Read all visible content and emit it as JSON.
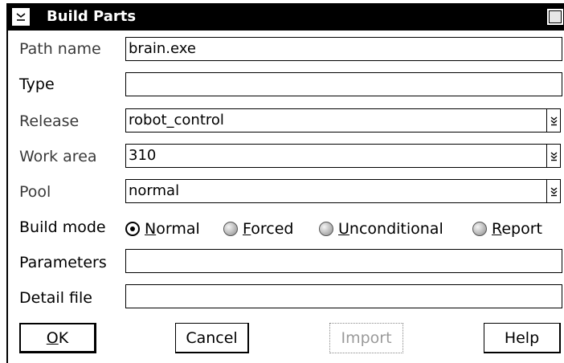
{
  "window": {
    "title": "Build Parts"
  },
  "labels": {
    "path_name": "Path name",
    "type": "Type",
    "release": "Release",
    "work_area": "Work area",
    "pool": "Pool",
    "build_mode": "Build mode",
    "parameters": "Parameters",
    "detail_file": "Detail file"
  },
  "fields": {
    "path_name": "brain.exe",
    "type": "",
    "release": "robot_control",
    "work_area": "310",
    "pool": "normal",
    "parameters": "",
    "detail_file": ""
  },
  "build_mode": {
    "selected": "Normal",
    "options": [
      {
        "mnemonic": "N",
        "rest": "ormal"
      },
      {
        "mnemonic": "F",
        "rest": "orced"
      },
      {
        "mnemonic": "U",
        "rest": "nconditional"
      },
      {
        "mnemonic": "R",
        "rest": "eport"
      }
    ]
  },
  "buttons": {
    "ok_mnemonic": "O",
    "ok_rest": "K",
    "cancel": "Cancel",
    "import": "Import",
    "help": "Help"
  },
  "icons": {
    "system_menu": "system-menu-icon",
    "maximize": "maximize-icon",
    "dropdown": "dropdown-arrow-icon"
  }
}
